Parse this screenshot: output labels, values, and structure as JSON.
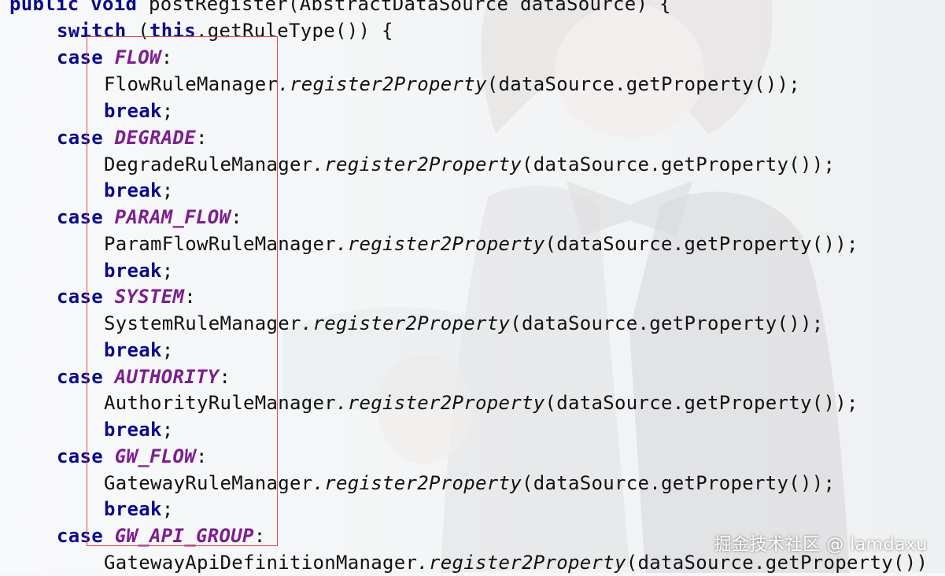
{
  "code": {
    "signature": {
      "kw_public": "public",
      "kw_void": "void",
      "rest": "postRegister(AbstractDataSource dataSource) {"
    },
    "switch_line": {
      "kw_switch": "switch",
      "open": "(",
      "kw_this": "this",
      "rest": ".getRuleType()) {"
    },
    "cases": [
      {
        "kw_case": "case",
        "constant": "FLOW",
        "colon": ":",
        "manager": "FlowRuleManager",
        "method": ".register2Property",
        "args": "(dataSource.getProperty());",
        "kw_break": "break",
        "semicolon": ";"
      },
      {
        "kw_case": "case",
        "constant": "DEGRADE",
        "colon": ":",
        "manager": "DegradeRuleManager",
        "method": ".register2Property",
        "args": "(dataSource.getProperty());",
        "kw_break": "break",
        "semicolon": ";"
      },
      {
        "kw_case": "case",
        "constant": "PARAM_FLOW",
        "colon": ":",
        "manager": "ParamFlowRuleManager",
        "method": ".register2Property",
        "args": "(dataSource.getProperty());",
        "kw_break": "break",
        "semicolon": ";"
      },
      {
        "kw_case": "case",
        "constant": "SYSTEM",
        "colon": ":",
        "manager": "SystemRuleManager",
        "method": ".register2Property",
        "args": "(dataSource.getProperty());",
        "kw_break": "break",
        "semicolon": ";"
      },
      {
        "kw_case": "case",
        "constant": "AUTHORITY",
        "colon": ":",
        "manager": "AuthorityRuleManager",
        "method": ".register2Property",
        "args": "(dataSource.getProperty());",
        "kw_break": "break",
        "semicolon": ";"
      },
      {
        "kw_case": "case",
        "constant": "GW_FLOW",
        "colon": ":",
        "manager": "GatewayRuleManager",
        "method": ".register2Property",
        "args": "(dataSource.getProperty());",
        "kw_break": "break",
        "semicolon": ";"
      },
      {
        "kw_case": "case",
        "constant": "GW_API_GROUP",
        "colon": ":",
        "manager": "GatewayApiDefinitionManager",
        "method": ".register2Property",
        "args": "(dataSource.getProperty())"
      }
    ]
  },
  "watermark": "掘金技术社区 @ lamdaxu",
  "colors": {
    "keyword": "#0b0b8a",
    "constant": "#7c1f8e",
    "highlight_box": "#e3494c"
  }
}
